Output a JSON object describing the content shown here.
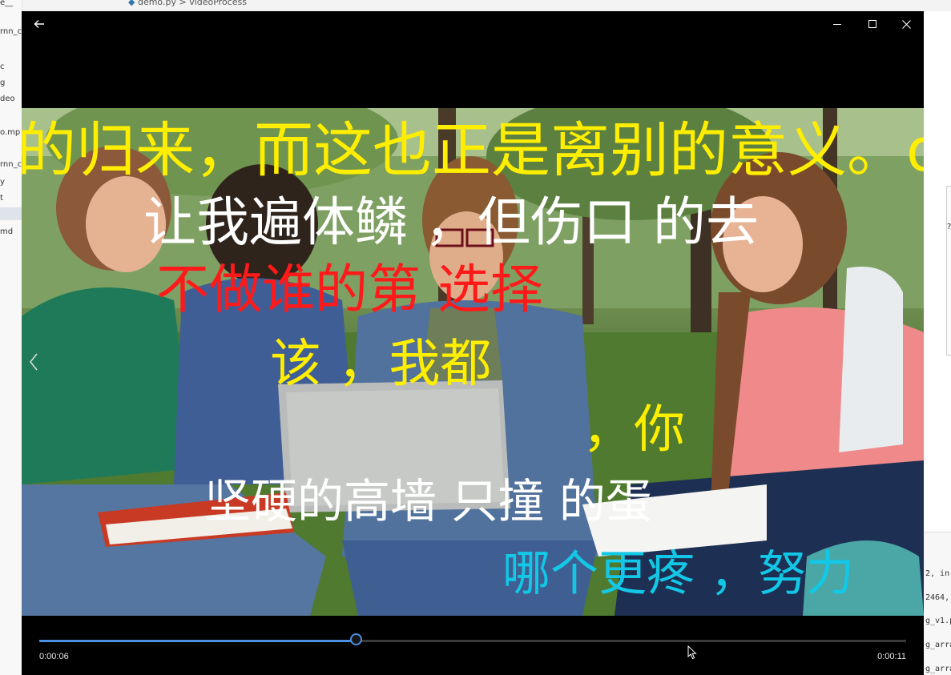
{
  "ide": {
    "breadcrumb": {
      "file": "demo.py",
      "separator": ">",
      "symbol": "videoProcess"
    },
    "sidebar_items": [
      "e__",
      "rnn_c",
      "c",
      "g",
      "deo",
      "o.mp",
      "rnn_c",
      "y",
      "t",
      "md"
    ],
    "right_code_lines": [
      "2, in",
      "2464,",
      "g_v1.p",
      "g_arra",
      "g_arra"
    ]
  },
  "player": {
    "nav": {
      "back_icon": "arrow-left-icon",
      "prev_icon": "chevron-left-icon"
    },
    "window_controls": {
      "minimize_icon": "minimize-icon",
      "maximize_icon": "maximize-icon",
      "close_icon": "close-icon"
    },
    "subtitles": {
      "line1": "的归来，而这也正是离别的意义。o",
      "line2": "让我遍体鳞 ，但伤口 的去",
      "line3": "不做谁的第 选择",
      "line4": "该 ，我都",
      "line5": "，你",
      "line6": "坚硬的高墙 只撞 的蛋",
      "line7": "哪个更疼 ，努力"
    },
    "progress": {
      "current_time": "0:00:06",
      "total_time": "0:00:11",
      "fraction": 0.366
    },
    "colors": {
      "accent": "#4a8fe2",
      "subtitle_yellow": "#ffee00",
      "subtitle_red": "#ff1a1a",
      "subtitle_cyan": "#12c8e6",
      "subtitle_white": "#ffffff"
    }
  }
}
